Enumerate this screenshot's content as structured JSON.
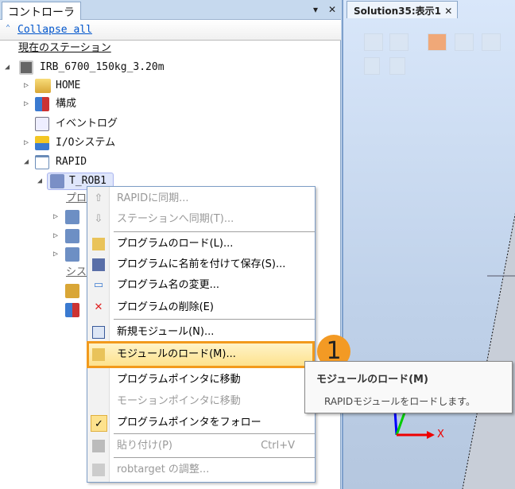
{
  "left_panel": {
    "tab": "コントローラ",
    "collapse_all": "Collapse all"
  },
  "tree": {
    "station": "現在のステーション",
    "controller": "IRB_6700_150kg_3.20m",
    "home": "HOME",
    "config": "構成",
    "event_log": "イベントログ",
    "io": "I/Oシステム",
    "rapid": "RAPID",
    "task": "T_ROB1",
    "program_modules_header": "プロ",
    "system_modules_header": "シス"
  },
  "right_panel": {
    "tab": "Solution35:表示1",
    "axis_x": "X"
  },
  "context_menu": {
    "items": [
      {
        "label": "RAPIDに同期...",
        "enabled": false
      },
      {
        "label": "ステーションへ同期(T)...",
        "enabled": false
      },
      {
        "label": "プログラムのロード(L)...",
        "enabled": true
      },
      {
        "label": "プログラムに名前を付けて保存(S)...",
        "enabled": true
      },
      {
        "label": "プログラム名の変更...",
        "enabled": true
      },
      {
        "label": "プログラムの削除(E)",
        "enabled": true
      },
      {
        "label": "新規モジュール(N)...",
        "enabled": true
      },
      {
        "label": "モジュールのロード(M)...",
        "enabled": true
      },
      {
        "label": "プログラムポインタに移動",
        "enabled": true
      },
      {
        "label": "モーションポインタに移動",
        "enabled": false
      },
      {
        "label": "プログラムポインタをフォロー",
        "enabled": true,
        "checked": true
      },
      {
        "label": "貼り付け(P)",
        "enabled": false,
        "shortcut": "Ctrl+V"
      },
      {
        "label": "robtarget の調整...",
        "enabled": false
      }
    ]
  },
  "tooltip": {
    "title": "モジュールのロード(M)",
    "text": "RAPIDモジュールをロードします。"
  },
  "callout": {
    "number": "1",
    "color": "#f39a24"
  }
}
